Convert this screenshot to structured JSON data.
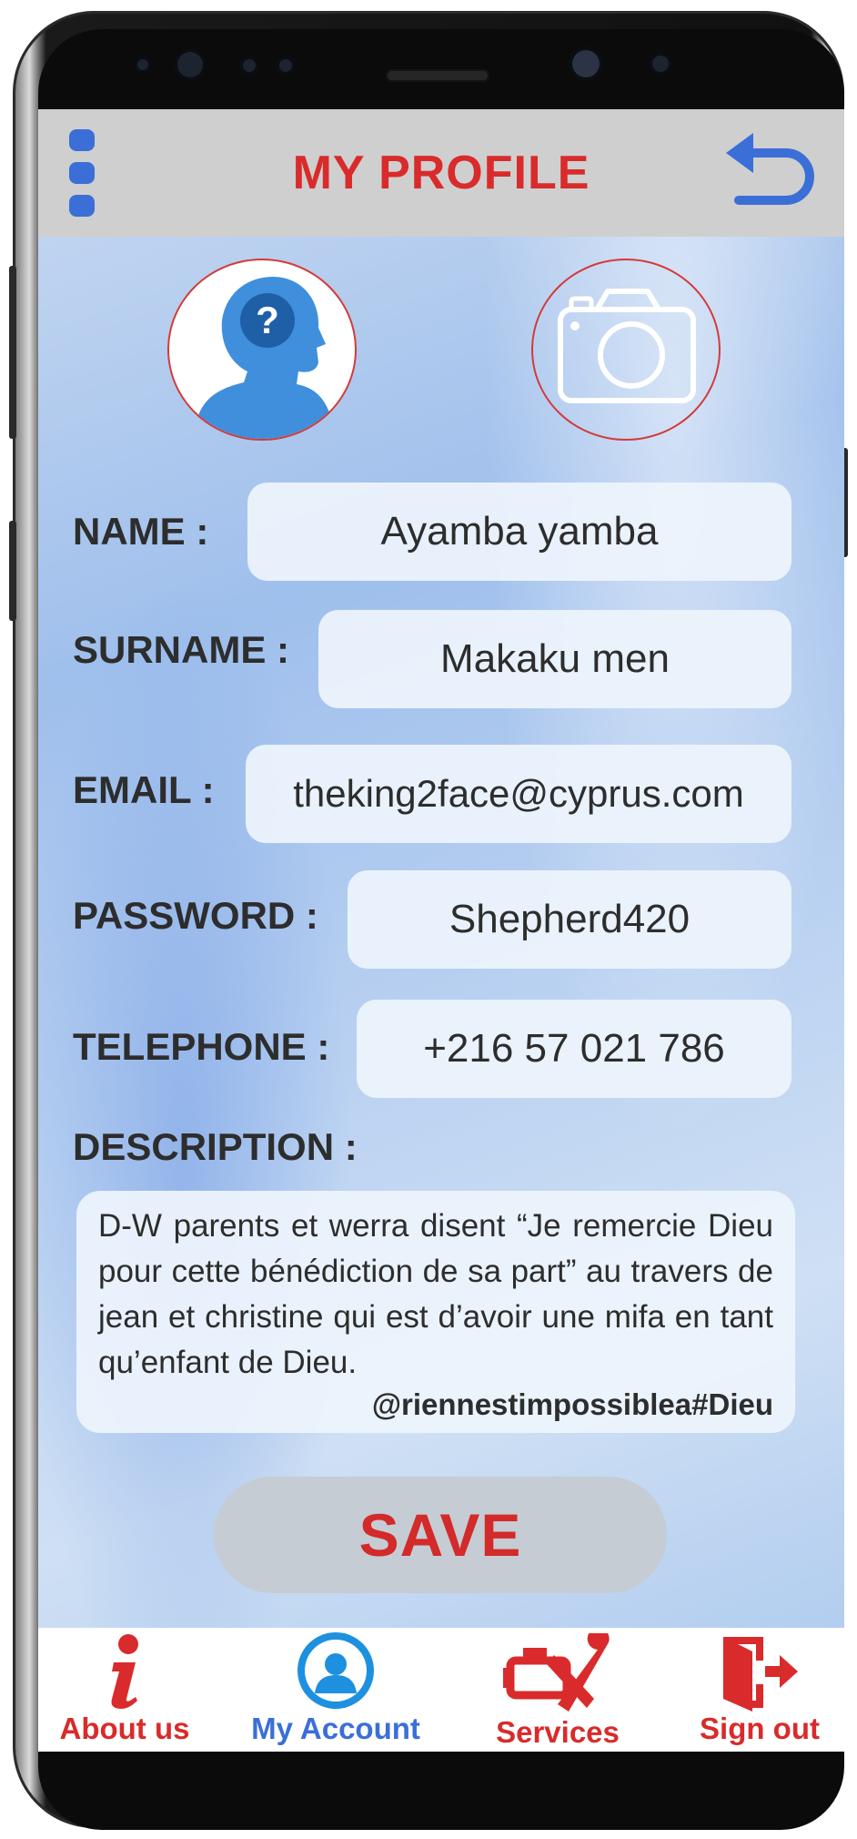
{
  "header": {
    "title": "MY PROFILE"
  },
  "form": {
    "name": {
      "label": "NAME :",
      "value": "Ayamba yamba"
    },
    "surname": {
      "label": "SURNAME :",
      "value": "Makaku men"
    },
    "email": {
      "label": "EMAIL :",
      "value": "theking2face@cyprus.com"
    },
    "password": {
      "label": "PASSWORD :",
      "value": "Shepherd420"
    },
    "telephone": {
      "label": "TELEPHONE :",
      "value": "+216 57 021 786"
    },
    "description": {
      "label": "DESCRIPTION :",
      "value": "D-W parents et werra disent “Je remercie Dieu pour cette bénédiction de sa part” au travers de jean et christine qui est d’avoir une mifa en tant qu’enfant de Dieu.",
      "tag": "@riennestimpossiblea#Dieu"
    }
  },
  "save_label": "SAVE",
  "nav": {
    "about": "About us",
    "account": "My Account",
    "services": "Services",
    "signout": "Sign out"
  },
  "colors": {
    "accent_red": "#d92b2b",
    "accent_blue": "#3b6fd7",
    "appbar_gray": "#cfcfcf"
  },
  "icons": [
    "menu-icon",
    "back-arrow-icon",
    "profile-unknown-icon",
    "camera-icon",
    "info-icon",
    "user-icon",
    "engine-tools-icon",
    "exit-door-icon"
  ]
}
